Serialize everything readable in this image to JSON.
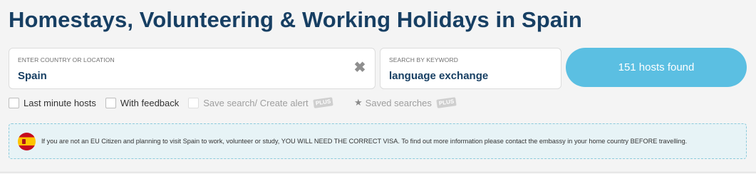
{
  "page": {
    "title": "Homestays, Volunteering & Working Holidays in Spain"
  },
  "search": {
    "location_label": "ENTER COUNTRY OR LOCATION",
    "location_value": "Spain",
    "keyword_label": "SEARCH BY KEYWORD",
    "keyword_value": "language exchange",
    "results_button": "151 hosts found"
  },
  "filters": {
    "last_minute": "Last minute hosts",
    "with_feedback": "With feedback",
    "save_search": "Save search/ Create alert",
    "saved_searches": "Saved searches",
    "plus_badge": "PLUS"
  },
  "notice": {
    "text": "If you are not an EU Citizen and planning to visit Spain to work, volunteer or study, YOU WILL NEED THE CORRECT VISA. To find out more information please contact the embassy in your home country BEFORE travelling."
  },
  "icons": {
    "clear": "close-icon",
    "star": "star-icon",
    "flag": "spain-flag-icon"
  },
  "colors": {
    "title": "#173f63",
    "button": "#5bbfe2",
    "notice_bg": "#e7f3f6",
    "notice_border": "#8dcbdc"
  }
}
